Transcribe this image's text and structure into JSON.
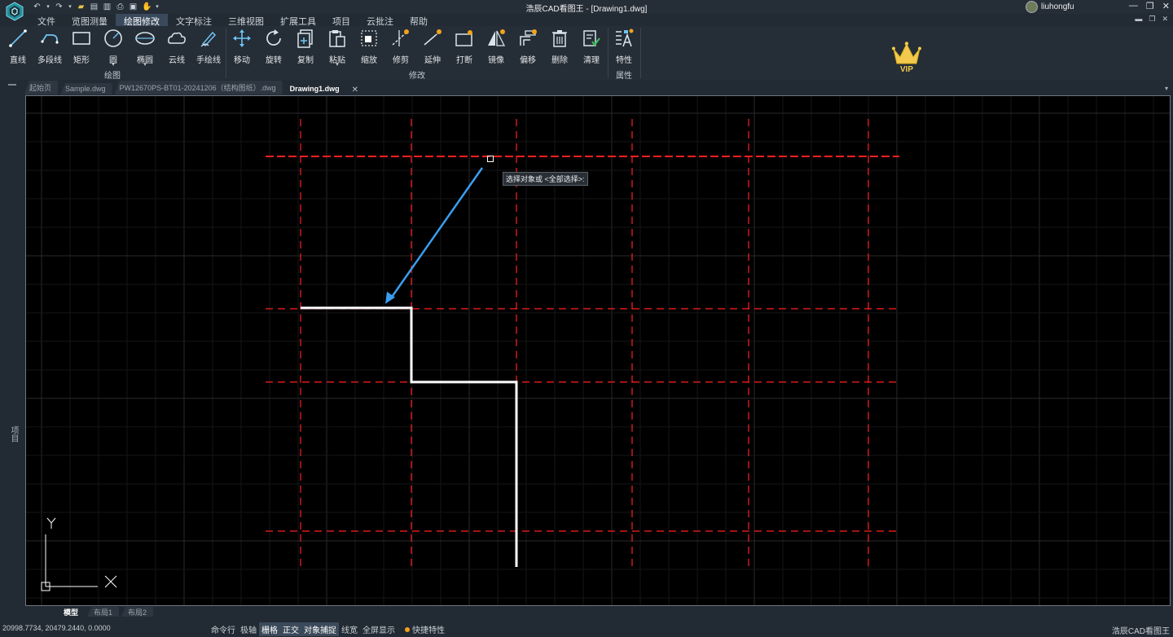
{
  "window": {
    "title": "浩辰CAD看图王 - [Drawing1.dwg]",
    "user": "liuhongfu",
    "buttons": [
      "—",
      "❐",
      "✕"
    ]
  },
  "menu": [
    {
      "label": "文件",
      "active": false
    },
    {
      "label": "览图测量",
      "active": false
    },
    {
      "label": "绘图修改",
      "active": true
    },
    {
      "label": "文字标注",
      "active": false
    },
    {
      "label": "三维视图",
      "active": false
    },
    {
      "label": "扩展工具",
      "active": false
    },
    {
      "label": "项目",
      "active": false
    },
    {
      "label": "云批注",
      "active": false
    },
    {
      "label": "帮助",
      "active": false
    }
  ],
  "ribbon": {
    "draw_group": {
      "title": "绘图",
      "items": [
        {
          "label": "直线",
          "icon": "line-icon"
        },
        {
          "label": "多段线",
          "icon": "polyline-icon"
        },
        {
          "label": "矩形",
          "icon": "rectangle-icon"
        },
        {
          "label": "圆",
          "icon": "circle-icon",
          "has_dropdown": true
        },
        {
          "label": "椭圆",
          "icon": "ellipse-icon",
          "has_dropdown": true
        },
        {
          "label": "云线",
          "icon": "cloud-icon"
        },
        {
          "label": "手绘线",
          "icon": "pen-icon"
        }
      ]
    },
    "modify_group": {
      "title": "修改",
      "items": [
        {
          "label": "移动",
          "icon": "move-icon"
        },
        {
          "label": "旋转",
          "icon": "rotate-icon"
        },
        {
          "label": "复制",
          "icon": "copy-icon"
        },
        {
          "label": "粘贴",
          "icon": "paste-icon",
          "has_dropdown": true
        },
        {
          "label": "缩放",
          "icon": "scale-icon"
        },
        {
          "label": "修剪",
          "icon": "trim-icon"
        },
        {
          "label": "延伸",
          "icon": "extend-icon"
        },
        {
          "label": "打断",
          "icon": "break-icon"
        },
        {
          "label": "镜像",
          "icon": "mirror-icon"
        },
        {
          "label": "偏移",
          "icon": "offset-icon"
        },
        {
          "label": "删除",
          "icon": "delete-icon"
        },
        {
          "label": "清理",
          "icon": "purge-icon"
        }
      ]
    },
    "properties_group": {
      "title": "属性",
      "items": [
        {
          "label": "特性",
          "icon": "properties-icon"
        }
      ]
    },
    "vip_label": "VIP"
  },
  "left_panel": {
    "label": "项目"
  },
  "doc_tabs": [
    {
      "label": "起始页",
      "active": false
    },
    {
      "label": "Sample.dwg",
      "active": false
    },
    {
      "label": "PW12670PS-BT01-20241206（结构图纸）.dwg",
      "active": false
    },
    {
      "label": "Drawing1.dwg",
      "active": true
    }
  ],
  "canvas": {
    "prompt": "选择对象或 <全部选择>:",
    "ucs_x": "X",
    "ucs_y": "Y",
    "background": "#000000",
    "grid_color": "#1c1c1c",
    "axis_line_color": "#ff2020",
    "polyline_color": "#ffffff",
    "arrow_color": "#3a9ef0"
  },
  "layout_tabs": [
    {
      "label": "模型",
      "active": true
    },
    {
      "label": "布局1",
      "active": false
    },
    {
      "label": "布局2",
      "active": false
    }
  ],
  "status": {
    "coordinates": "20998.7734, 20479.2440, 0.0000",
    "toggles": [
      {
        "label": "命令行",
        "on": false
      },
      {
        "label": "极轴",
        "on": false
      },
      {
        "label": "栅格",
        "on": true
      },
      {
        "label": "正交",
        "on": true
      },
      {
        "label": "对象捕捉",
        "on": true
      },
      {
        "label": "线宽",
        "on": false
      },
      {
        "label": "全屏显示",
        "on": false
      }
    ],
    "quick_props": "快捷特性",
    "brand": "浩辰CAD看图王"
  }
}
